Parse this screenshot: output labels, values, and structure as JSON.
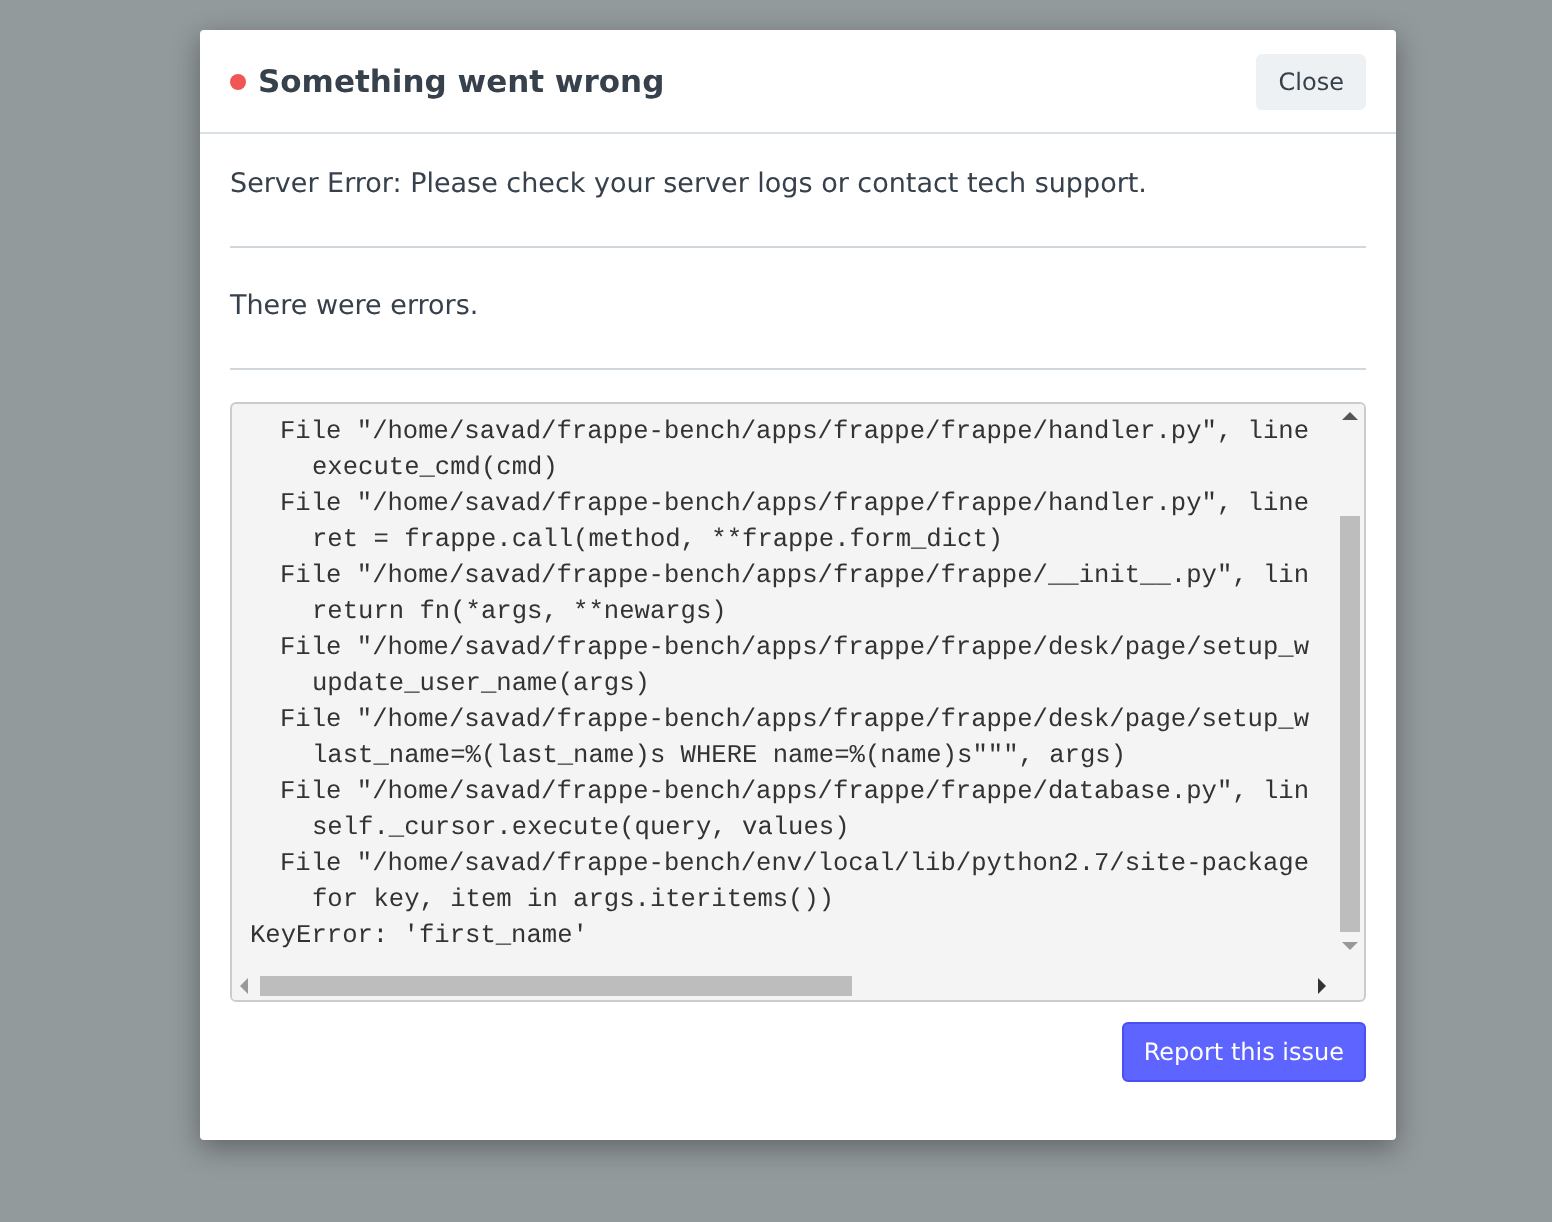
{
  "dialog": {
    "title": "Something went wrong",
    "close_button": "Close",
    "message": "Server Error: Please check your server logs or contact tech support.",
    "subtitle": "There were errors.",
    "traceback": [
      {
        "kind": "frame",
        "text": "File \"/home/savad/frappe-bench/apps/frappe/frappe/handler.py\", line"
      },
      {
        "kind": "code",
        "text": "execute_cmd(cmd)"
      },
      {
        "kind": "frame",
        "text": "File \"/home/savad/frappe-bench/apps/frappe/frappe/handler.py\", line"
      },
      {
        "kind": "code",
        "text": "ret = frappe.call(method, **frappe.form_dict)"
      },
      {
        "kind": "frame",
        "text": "File \"/home/savad/frappe-bench/apps/frappe/frappe/__init__.py\", lin"
      },
      {
        "kind": "code",
        "text": "return fn(*args, **newargs)"
      },
      {
        "kind": "frame",
        "text": "File \"/home/savad/frappe-bench/apps/frappe/frappe/desk/page/setup_w"
      },
      {
        "kind": "code",
        "text": "update_user_name(args)"
      },
      {
        "kind": "frame",
        "text": "File \"/home/savad/frappe-bench/apps/frappe/frappe/desk/page/setup_w"
      },
      {
        "kind": "code",
        "text": "last_name=%(last_name)s WHERE name=%(name)s\"\"\", args)"
      },
      {
        "kind": "frame",
        "text": "File \"/home/savad/frappe-bench/apps/frappe/frappe/database.py\", lin"
      },
      {
        "kind": "code",
        "text": "self._cursor.execute(query, values)"
      },
      {
        "kind": "frame",
        "text": "File \"/home/savad/frappe-bench/env/local/lib/python2.7/site-package"
      },
      {
        "kind": "code",
        "text": "for key, item in args.iteritems())"
      },
      {
        "kind": "error",
        "text": "KeyError: 'first_name'"
      }
    ],
    "report_button": "Report this issue"
  }
}
